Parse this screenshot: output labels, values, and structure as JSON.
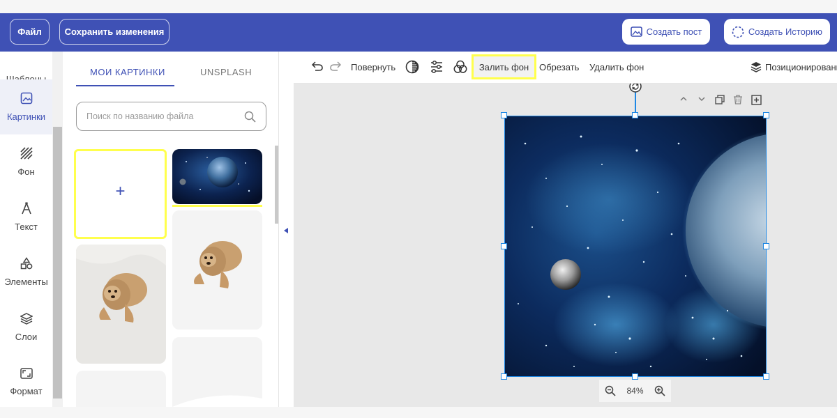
{
  "header": {
    "file_label": "Файл",
    "save_label": "Сохранить изменения",
    "create_post_label": "Создать пост",
    "create_story_label": "Создать Историю"
  },
  "sidebar": {
    "items": [
      {
        "label": "Шаблоны"
      },
      {
        "label": "Картинки"
      },
      {
        "label": "Фон"
      },
      {
        "label": "Текст"
      },
      {
        "label": "Элементы"
      },
      {
        "label": "Слои"
      },
      {
        "label": "Формат"
      }
    ]
  },
  "panel": {
    "tabs": [
      {
        "label": "МОИ КАРТИНКИ"
      },
      {
        "label": "UNSPLASH"
      }
    ],
    "search_placeholder": "Поиск по названию файла",
    "upload_symbol": "+"
  },
  "toolbar": {
    "rotate_label": "Повернуть",
    "fill_bg_label": "Залить фон",
    "crop_label": "Обрезать",
    "remove_bg_label": "Удалить фон",
    "position_label": "Позиционировани"
  },
  "canvas": {
    "zoom_text": "84%"
  },
  "colors": {
    "brand": "#3f51b5",
    "highlight": "#ffff4d",
    "selection": "#1e88e5"
  }
}
